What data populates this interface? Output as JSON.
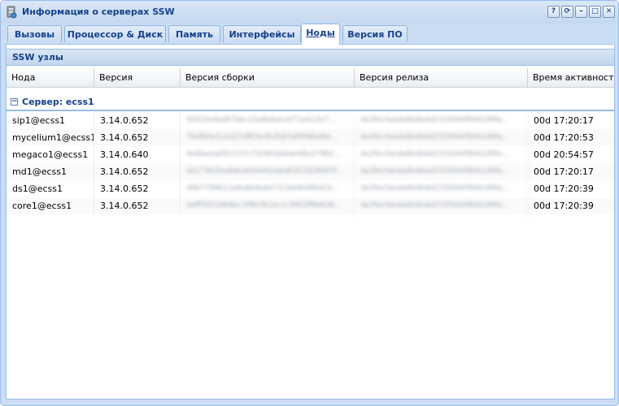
{
  "window": {
    "title": "Информация о серверах SSW",
    "tools": [
      "?",
      "⟳",
      "–",
      "□",
      "✕"
    ]
  },
  "tabs": [
    {
      "label": "Вызовы",
      "active": false
    },
    {
      "label": "Процессор & Диск",
      "active": false
    },
    {
      "label": "Память",
      "active": false
    },
    {
      "label": "Интерфейсы",
      "active": false
    },
    {
      "label": "Ноды",
      "active": true
    },
    {
      "label": "Версия ПО",
      "active": false
    }
  ],
  "panel": {
    "title": "SSW узлы"
  },
  "columns": [
    "Нода",
    "Версия",
    "Версия сборки",
    "Версия релиза",
    "Время активности"
  ],
  "group": {
    "label": "Сервер: ecss1",
    "toggle": "−"
  },
  "rows": [
    {
      "node": "sip1@ecss1",
      "version": "3.14.0.652",
      "build": "5fd15e4bd87bbc22a8ebacef71e613e7...",
      "release": "da3fecfaeda6b4b4d2335bfef9041d9fa...",
      "uptime": "00d 17:20:17"
    },
    {
      "node": "mycelium1@ecss1",
      "version": "3.14.0.652",
      "build": "7fe8bfa312d27df63e3b2b83af958bd9e...",
      "release": "da3fecfaeda6b4b4d2335bfef9041d9fa...",
      "uptime": "00d 17:20:53"
    },
    {
      "node": "megaco1@ecss1",
      "version": "3.14.0.640",
      "build": "9e8beea091237c7329b5b6ab08e27962...",
      "release": "da3fecfaeda6b4b4d2335bfef9041d9fa...",
      "uptime": "00d 20:54:57"
    },
    {
      "node": "md1@ecss1",
      "version": "3.14.0.652",
      "build": "a0174b2ba84eab0d442a8a6351929d97f...",
      "release": "da3fecfaeda6b4b4d2335bfef9041d9fa...",
      "uptime": "00d 17:20:17"
    },
    {
      "node": "ds1@ecss1",
      "version": "3.14.0.652",
      "build": "d9b7788b12a6a8e6a6e7216d4e9fbd15...",
      "release": "da3fecfaeda6b4b4d2335bfef9041d9fa...",
      "uptime": "00d 17:20:39"
    },
    {
      "node": "core1@ecss1",
      "version": "3.14.0.652",
      "build": "daff59334b6bc1f9b761ec1c59f1ff8b636...",
      "release": "da3fecfaeda6b4b4d2335bfef9041d9fa...",
      "uptime": "00d 17:20:39"
    }
  ]
}
